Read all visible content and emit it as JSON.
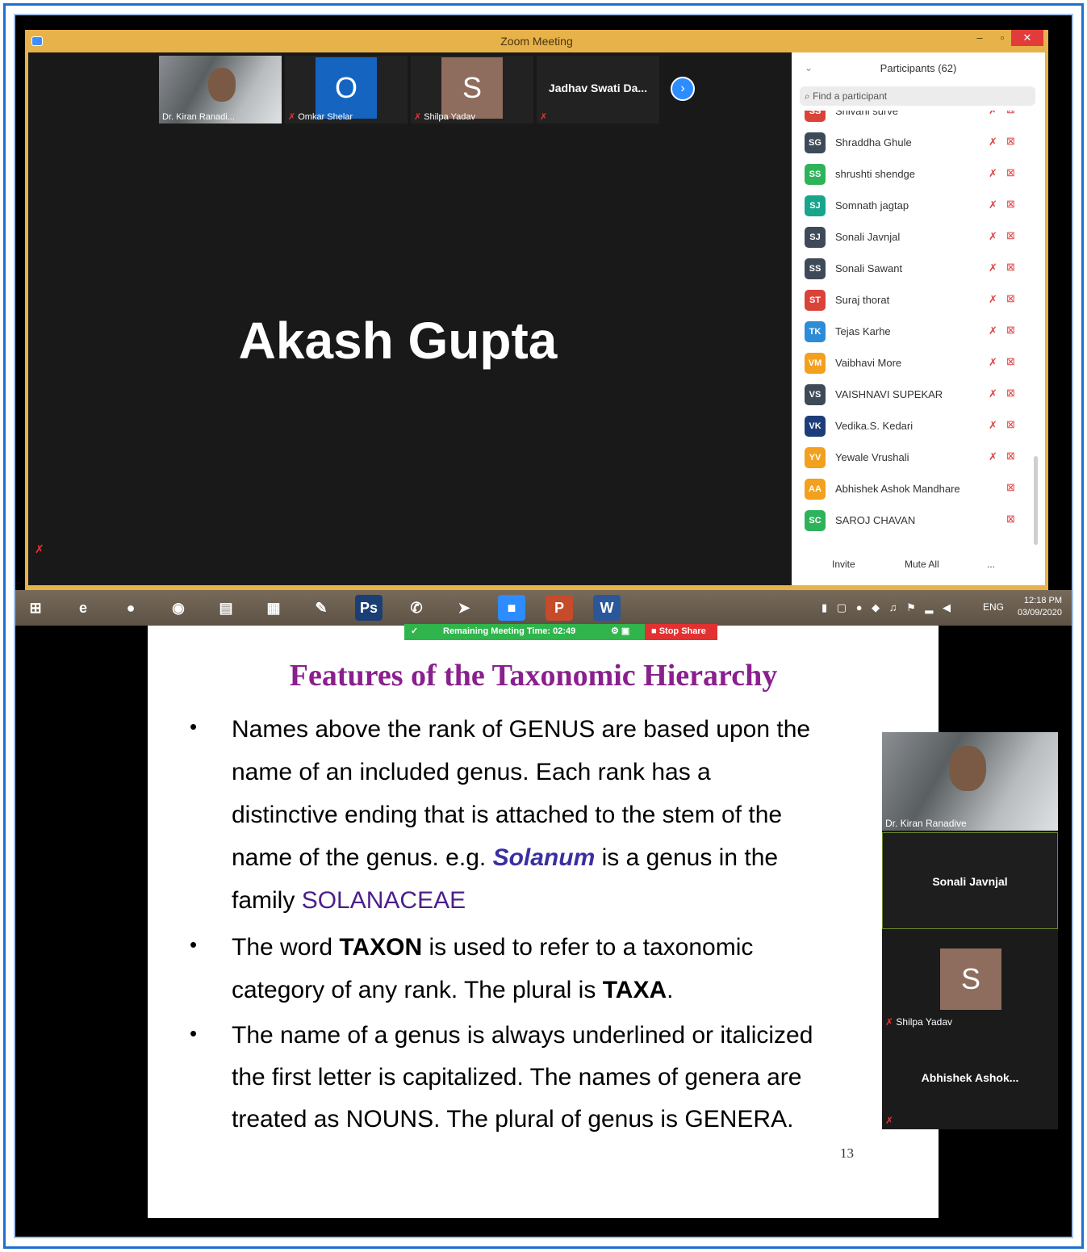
{
  "window": {
    "title": "Zoom Meeting",
    "min": "–",
    "max": "▫",
    "close": "✕"
  },
  "thumbnails": [
    {
      "name": "Dr. Kiran Ranadi...",
      "muted": false
    },
    {
      "name": "Omkar Shelar",
      "initial": "O",
      "color": "#1565c0",
      "muted": true
    },
    {
      "name": "Shilpa Yadav",
      "initial": "S",
      "color": "#8e6d5e",
      "muted": true
    },
    {
      "name": "Jadhav Swati Da...",
      "muted": true
    }
  ],
  "active_speaker": "Akash Gupta",
  "participants": {
    "header": "Participants (62)",
    "search_placeholder": "Find a participant",
    "items": [
      {
        "initials": "SS",
        "name": "Shivani surve",
        "color": "#d9433a",
        "mic_muted": true
      },
      {
        "initials": "SG",
        "name": "Shraddha Ghule",
        "color": "#3f4a59",
        "mic_muted": true
      },
      {
        "initials": "SS",
        "name": "shrushti shendge",
        "color": "#2fb35a",
        "mic_muted": true
      },
      {
        "initials": "SJ",
        "name": "Somnath jagtap",
        "color": "#18a58c",
        "mic_muted": true
      },
      {
        "initials": "SJ",
        "name": "Sonali Javnjal",
        "color": "#3f4a59",
        "mic_muted": true
      },
      {
        "initials": "SS",
        "name": "Sonali Sawant",
        "color": "#3f4a59",
        "mic_muted": true
      },
      {
        "initials": "ST",
        "name": "Suraj thorat",
        "color": "#d9433a",
        "mic_muted": true
      },
      {
        "initials": "TK",
        "name": "Tejas Karhe",
        "color": "#2d8cd6",
        "mic_muted": true
      },
      {
        "initials": "VM",
        "name": "Vaibhavi More",
        "color": "#f2a01d",
        "mic_muted": true
      },
      {
        "initials": "VS",
        "name": "VAISHNAVI SUPEKAR",
        "color": "#3f4a59",
        "mic_muted": true
      },
      {
        "initials": "VK",
        "name": "Vedika.S. Kedari",
        "color": "#1d3d7a",
        "mic_muted": true
      },
      {
        "initials": "YV",
        "name": "Yewale Vrushali",
        "color": "#f2a01d",
        "mic_muted": true
      },
      {
        "initials": "AA",
        "name": "Abhishek Ashok Mandhare",
        "color": "#f2a01d",
        "mic_muted": false
      },
      {
        "initials": "SC",
        "name": "SAROJ CHAVAN",
        "color": "#2fb35a",
        "mic_muted": false
      }
    ],
    "invite": "Invite",
    "mute_all": "Mute All",
    "more": "..."
  },
  "taskbar": {
    "apps": [
      {
        "icon": "windows-start-icon",
        "glyph": "⊞",
        "color": "transparent"
      },
      {
        "icon": "internet-explorer-icon",
        "glyph": "e",
        "color": "transparent"
      },
      {
        "icon": "chrome-icon",
        "glyph": "●",
        "color": "transparent"
      },
      {
        "icon": "media-player-icon",
        "glyph": "◉",
        "color": "transparent"
      },
      {
        "icon": "file-explorer-icon",
        "glyph": "▤",
        "color": "transparent"
      },
      {
        "icon": "calculator-icon",
        "glyph": "▦",
        "color": "transparent"
      },
      {
        "icon": "paint-icon",
        "glyph": "✎",
        "color": "transparent"
      },
      {
        "icon": "photoshop-icon",
        "glyph": "Ps",
        "color": "#1b3f74"
      },
      {
        "icon": "whatsapp-icon",
        "glyph": "✆",
        "color": "transparent"
      },
      {
        "icon": "telegram-icon",
        "glyph": "➤",
        "color": "transparent"
      },
      {
        "icon": "zoom-icon",
        "glyph": "■",
        "color": "#2d8cff"
      },
      {
        "icon": "powerpoint-icon",
        "glyph": "P",
        "color": "#c64b2a"
      },
      {
        "icon": "word-icon",
        "glyph": "W",
        "color": "#2b579a"
      }
    ],
    "lang": "ENG",
    "time": "12:18 PM",
    "date": "03/09/2020"
  },
  "meeting_bar": {
    "remaining": "Remaining Meeting Time: 02:49",
    "stop_share": "Stop Share"
  },
  "slide": {
    "title": "Features of the Taxonomic Hierarchy",
    "p1_a": "Names above the rank of GENUS are  based upon the",
    "p1_b": "name of an included genus. Each rank has a",
    "p1_c": "distinctive  ending that is attached to the stem of the",
    "p1_d1": "name of the genus. e.g. ",
    "p1_d_italic": "Solanum",
    "p1_d2": " is a genus in the",
    "p1_e1": "family ",
    "p1_e_family": "SOLANACEAE",
    "p2_a1": " The word ",
    "p2_a_bold": "TAXON",
    "p2_a2": " is used to refer to a taxonomic",
    "p2_b1": "category  of any rank. The plural is ",
    "p2_b_bold": "TAXA",
    "p2_b2": ".",
    "p3_a": "The name of a genus is always underlined or italicized",
    "p3_b": " the first letter is capitalized. The names of genera are",
    "p3_c": "treated  as NOUNS. The plural of genus is GENERA.",
    "page_number": "13"
  },
  "floating_videos": [
    {
      "name": "Dr. Kiran Ranadive"
    },
    {
      "name": "Sonali Javnjal"
    },
    {
      "name": "Shilpa Yadav",
      "initial": "S"
    },
    {
      "name": "Abhishek Ashok..."
    }
  ]
}
